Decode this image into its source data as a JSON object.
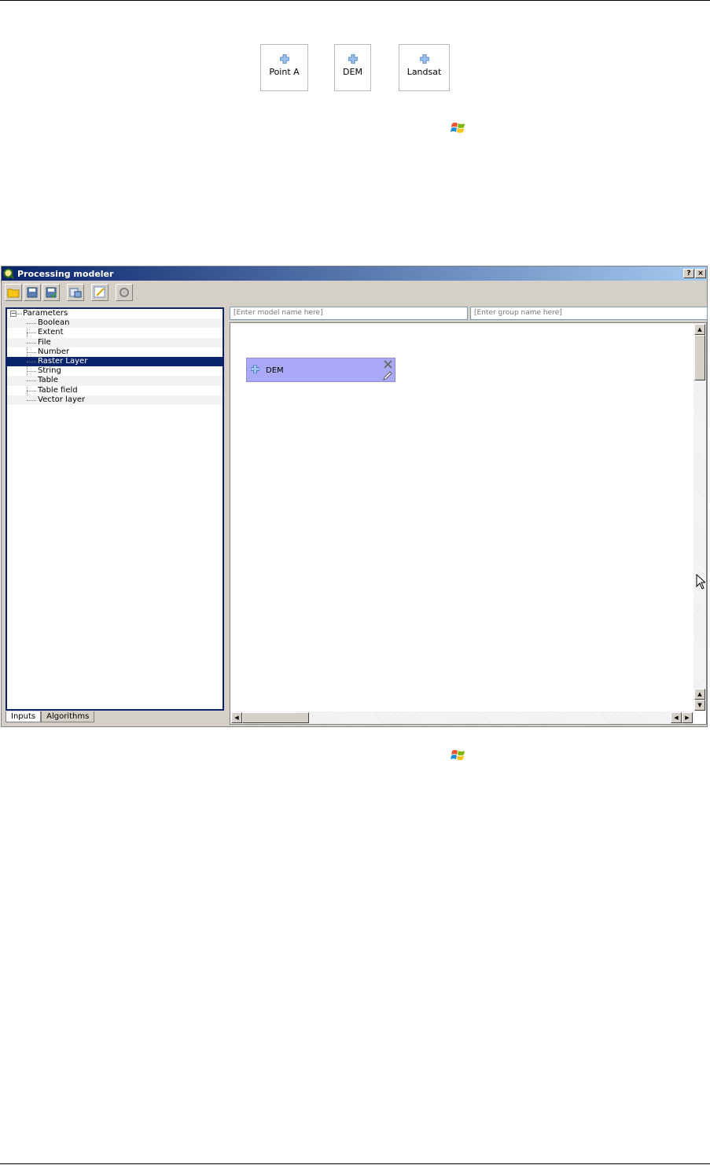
{
  "top_params": [
    {
      "label": "Point A"
    },
    {
      "label": "DEM"
    },
    {
      "label": "Landsat"
    }
  ],
  "window": {
    "title": "Processing modeler",
    "help_label": "?",
    "close_label": "×"
  },
  "toolbar": {
    "buttons": [
      "open-model-icon",
      "save-model-icon",
      "save-as-icon",
      "export-image-icon",
      "edit-help-icon",
      "run-model-icon"
    ]
  },
  "tree": {
    "root": "Parameters",
    "items": [
      "Boolean",
      "Extent",
      "File",
      "Number",
      "Raster Layer",
      "String",
      "Table",
      "Table field",
      "Vector layer"
    ],
    "selected": "Raster Layer"
  },
  "tabs": [
    "Inputs",
    "Algorithms"
  ],
  "model_name_placeholder": "[Enter model name here]",
  "group_name_placeholder": "[Enter group name here]",
  "canvas": {
    "node_label": "DEM"
  },
  "colors": {
    "selection": "#0a246a",
    "node_fill": "#a9a9f7"
  }
}
